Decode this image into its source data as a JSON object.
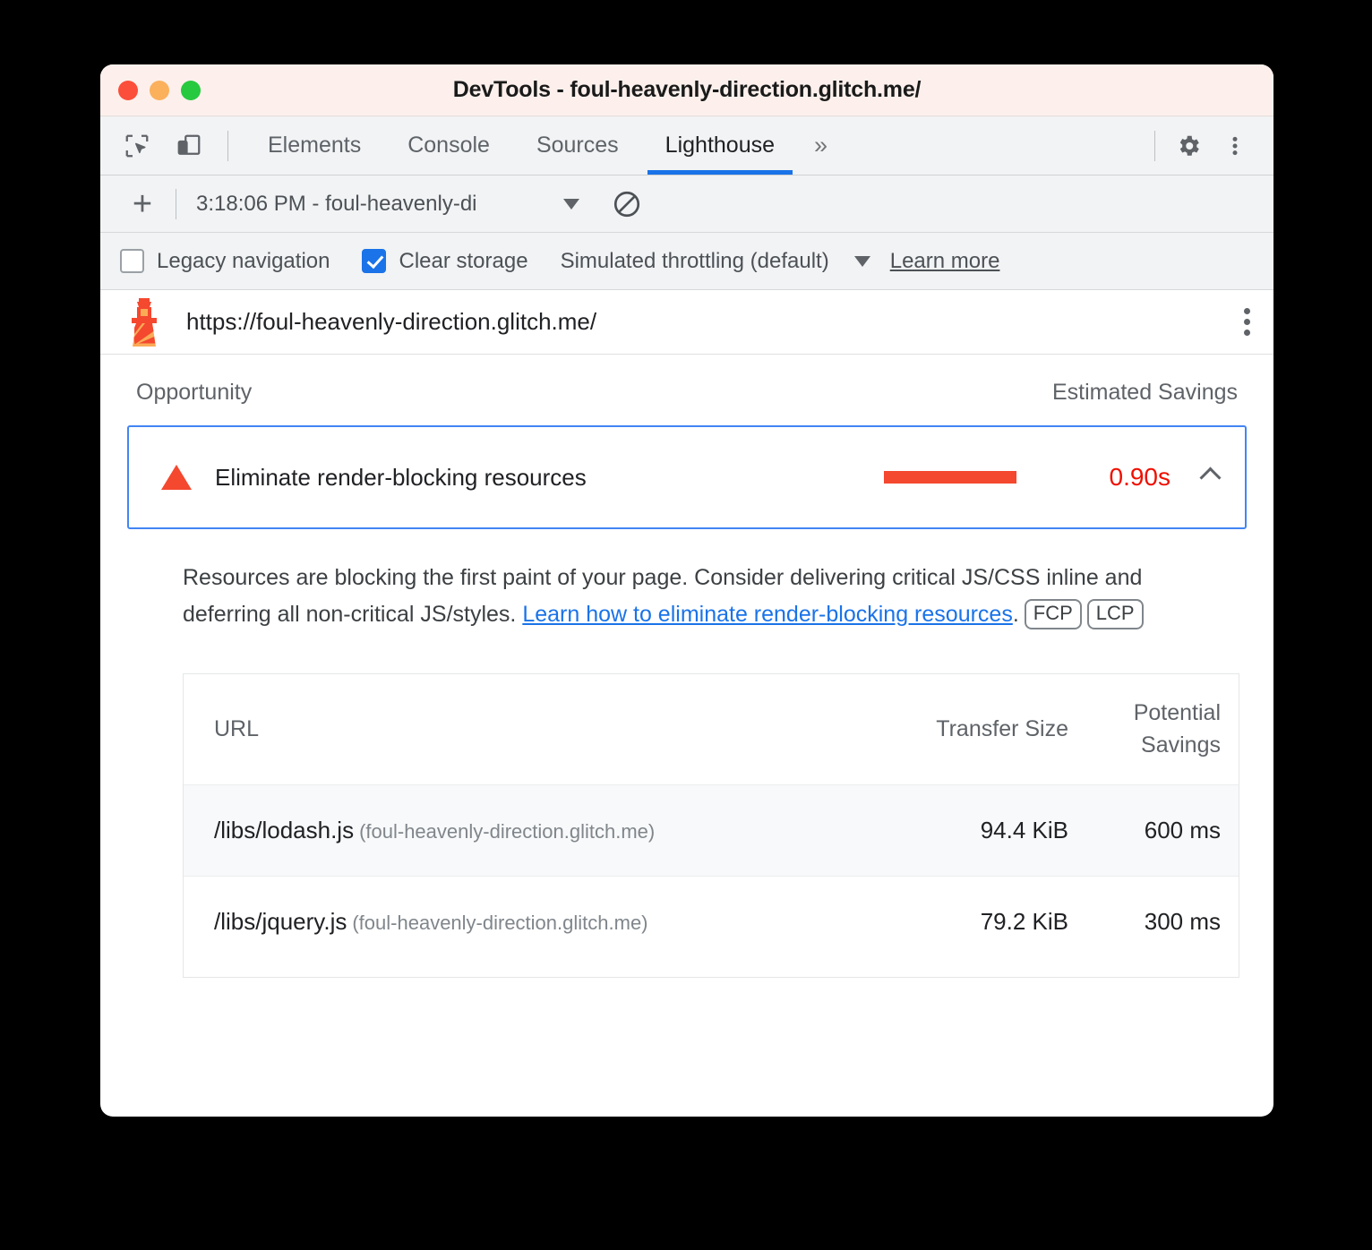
{
  "window": {
    "title": "DevTools - foul-heavenly-direction.glitch.me/",
    "traffic_lights": [
      "close",
      "minimize",
      "zoom"
    ]
  },
  "tabbar": {
    "inspect_icon": "inspect-element-icon",
    "device_icon": "device-toolbar-icon",
    "tabs": [
      {
        "label": "Elements",
        "active": false
      },
      {
        "label": "Console",
        "active": false
      },
      {
        "label": "Sources",
        "active": false
      },
      {
        "label": "Lighthouse",
        "active": true
      }
    ],
    "overflow": "»",
    "settings_icon": "gear-icon",
    "more_icon": "more-vertical-icon"
  },
  "lh_toolbar": {
    "add_label": "+",
    "run_selector_value": "3:18:06 PM - foul-heavenly-di",
    "clear_icon": "no-entry-icon"
  },
  "settings": {
    "legacy_navigation": {
      "label": "Legacy navigation",
      "checked": false
    },
    "clear_storage": {
      "label": "Clear storage",
      "checked": true
    },
    "throttling": "Simulated throttling (default)",
    "learn_more": "Learn more"
  },
  "audited": {
    "logo": "lighthouse-icon",
    "url": "https://foul-heavenly-direction.glitch.me/",
    "menu_icon": "more-vertical-icon"
  },
  "report": {
    "col_opportunity": "Opportunity",
    "col_estimated_savings": "Estimated Savings",
    "opportunity": {
      "severity_icon": "warning-triangle-icon",
      "title": "Eliminate render-blocking resources",
      "savings": "0.90s",
      "savings_color": "#f00f00",
      "bar_color": "#f4482f",
      "expanded": true,
      "toggle_icon": "chevron-up-icon"
    },
    "description": {
      "text_before": "Resources are blocking the first paint of your page. Consider delivering critical JS/CSS inline and deferring all non-critical JS/styles. ",
      "link_text": "Learn how to eliminate render-blocking resources",
      "text_after": ".",
      "badges": [
        "FCP",
        "LCP"
      ]
    },
    "table": {
      "headers": {
        "url": "URL",
        "transfer_size": "Transfer Size",
        "potential_savings": "Potential Savings"
      },
      "rows": [
        {
          "path": "/libs/lodash.js",
          "host": "(foul-heavenly-direction.glitch.me)",
          "transfer_size": "94.4 KiB",
          "potential_savings": "600 ms"
        },
        {
          "path": "/libs/jquery.js",
          "host": "(foul-heavenly-direction.glitch.me)",
          "transfer_size": "79.2 KiB",
          "potential_savings": "300 ms"
        }
      ]
    }
  }
}
